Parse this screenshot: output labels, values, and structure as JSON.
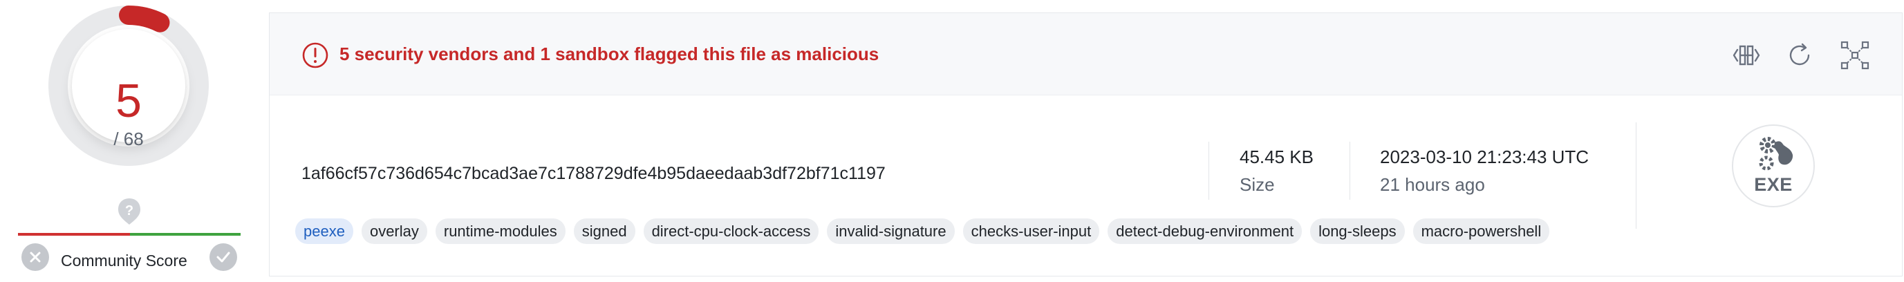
{
  "detection": {
    "score": "5",
    "total": "/ 68",
    "ring_fraction": 0.0735,
    "colors": {
      "malicious": "#c62828",
      "ring_track": "#e8e9eb"
    }
  },
  "community": {
    "label": "Community Score",
    "question_icon": "question-shield-icon",
    "downvote_icon": "close-icon",
    "upvote_icon": "check-icon"
  },
  "banner": {
    "alert_icon": "alert-circle-icon",
    "text": "5 security vendors and 1 sandbox flagged this file as malicious",
    "actions": [
      {
        "icon": "compare-icon"
      },
      {
        "icon": "reanalyze-icon"
      },
      {
        "icon": "graph-icon"
      }
    ]
  },
  "file": {
    "hash": "1af66cf57c736d654c7bcad3ae7c1788729dfe4b95daeedaab3df72bf71c1197",
    "size_value": "45.45 KB",
    "size_label": "Size",
    "date_value": "2023-03-10 21:23:43 UTC",
    "date_label": "21 hours ago",
    "type_label": "EXE",
    "type_icon": "gears-icon"
  },
  "tags": [
    "peexe",
    "overlay",
    "runtime-modules",
    "signed",
    "direct-cpu-clock-access",
    "invalid-signature",
    "checks-user-input",
    "detect-debug-environment",
    "long-sleeps",
    "macro-powershell"
  ]
}
